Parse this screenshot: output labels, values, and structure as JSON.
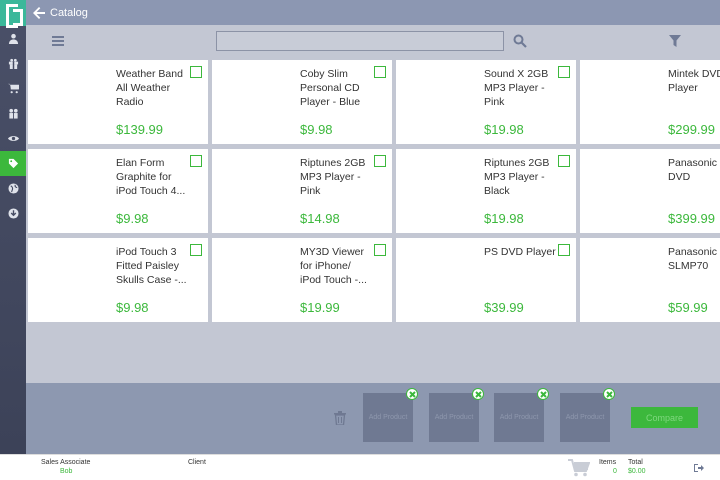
{
  "header": {
    "title": "Catalog"
  },
  "search": {
    "value": "",
    "placeholder": ""
  },
  "products": [
    {
      "name": "Weather Band All Weather Radio",
      "price": "$139.99"
    },
    {
      "name": "Coby Slim Personal CD Player - Blue",
      "price": "$9.98"
    },
    {
      "name": "Sound X 2GB MP3 Player - Pink",
      "price": "$19.98"
    },
    {
      "name": "Mintek DVD Player",
      "price": "$299.99"
    },
    {
      "name": "Elan Form Graphite for iPod Touch 4...",
      "price": "$9.98"
    },
    {
      "name": "Riptunes 2GB MP3 Player - Pink",
      "price": "$14.98"
    },
    {
      "name": "Riptunes 2GB MP3 Player - Black",
      "price": "$19.98"
    },
    {
      "name": "Panasonic P DVD",
      "price": "$399.99"
    },
    {
      "name": "iPod Touch 3 Fitted Paisley Skulls Case -...",
      "price": "$9.98"
    },
    {
      "name": "MY3D Viewer for iPhone/ iPod Touch -...",
      "price": "$19.99"
    },
    {
      "name": "PS DVD Player",
      "price": "$39.99"
    },
    {
      "name": "Panasonic SLMP70",
      "price": "$59.99"
    }
  ],
  "compare": {
    "slots": [
      "Add Product",
      "Add Product",
      "Add Product",
      "Add Product"
    ],
    "button_label": "Compare"
  },
  "footer": {
    "associate_label": "Sales Associate",
    "associate_value": "Bob",
    "client_label": "Client",
    "items_label": "Items",
    "items_value": "0",
    "total_label": "Total",
    "total_value": "$0.00"
  },
  "colors": {
    "accent": "#3cb83c",
    "sidebar": "#454b62",
    "header": "#8c97b2",
    "grid_bg": "#c3c7d3"
  }
}
